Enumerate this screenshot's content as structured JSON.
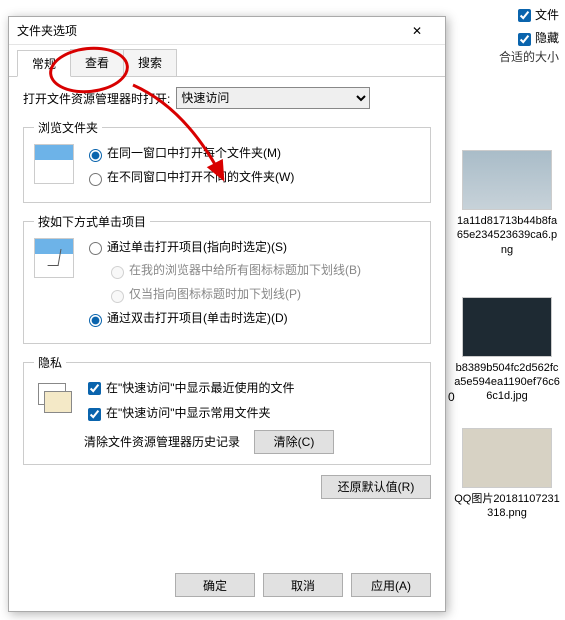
{
  "bg": {
    "check_file": "文件",
    "check_hidden": "隐藏",
    "fit_size": "合适的大小"
  },
  "dialog": {
    "title": "文件夹选项",
    "close": "✕",
    "tabs": {
      "general": "常规",
      "view": "查看",
      "search": "搜索"
    },
    "open_label": "打开文件资源管理器时打开:",
    "open_value": "快速访问",
    "browse": {
      "legend": "浏览文件夹",
      "r1": "在同一窗口中打开每个文件夹(M)",
      "r2": "在不同窗口中打开不同的文件夹(W)"
    },
    "click": {
      "legend": "按如下方式单击项目",
      "r1": "通过单击打开项目(指向时选定)(S)",
      "s1": "在我的浏览器中给所有图标标题加下划线(B)",
      "s2": "仅当指向图标标题时加下划线(P)",
      "r2": "通过双击打开项目(单击时选定)(D)"
    },
    "privacy": {
      "legend": "隐私",
      "c1": "在\"快速访问\"中显示最近使用的文件",
      "c2": "在\"快速访问\"中显示常用文件夹",
      "clear_label": "清除文件资源管理器历史记录",
      "clear_btn": "清除(C)"
    },
    "restore": "还原默认值(R)",
    "ok": "确定",
    "cancel": "取消",
    "apply": "应用(A)"
  },
  "thumbs": {
    "t1": "1a11d81713b44b8fa65e234523639ca6.png",
    "t2": "b8389b504fc2d562fca5e594ea1190ef76c66c1d.jpg",
    "t3": "QQ图片20181107231318.png",
    "partial": "0"
  }
}
